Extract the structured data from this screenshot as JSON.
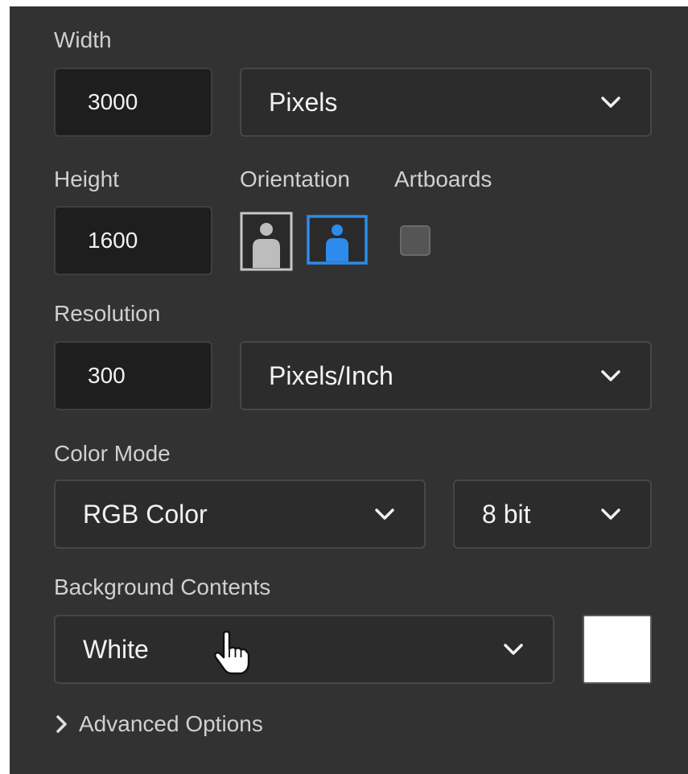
{
  "width": {
    "label": "Width",
    "value": "3000",
    "unit": "Pixels"
  },
  "height": {
    "label": "Height",
    "value": "1600"
  },
  "orientation": {
    "label": "Orientation",
    "selected": "landscape"
  },
  "artboards": {
    "label": "Artboards",
    "checked": false
  },
  "resolution": {
    "label": "Resolution",
    "value": "300",
    "unit": "Pixels/Inch"
  },
  "color_mode": {
    "label": "Color Mode",
    "mode": "RGB Color",
    "depth": "8 bit"
  },
  "background": {
    "label": "Background Contents",
    "value": "White",
    "swatch_color": "#ffffff"
  },
  "advanced": {
    "label": "Advanced Options"
  },
  "colors": {
    "panel": "#323232",
    "accent": "#2d8ceb"
  },
  "icons": [
    "chevron-down-icon",
    "portrait-orientation-icon",
    "landscape-orientation-icon",
    "chevron-right-icon",
    "hand-pointer-cursor-icon"
  ]
}
